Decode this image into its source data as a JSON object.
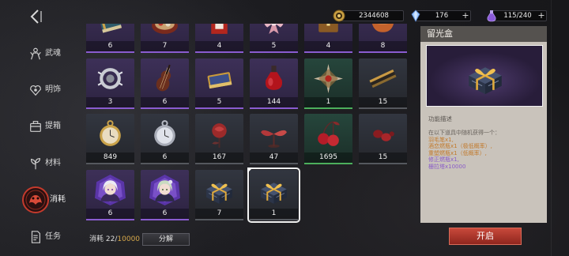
{
  "nav": {
    "back_icon": "back-icon"
  },
  "sidebar": {
    "items": [
      {
        "label": "武魂",
        "icon": "weapon-soul-icon"
      },
      {
        "label": "明饰",
        "icon": "ornament-icon"
      },
      {
        "label": "提箱",
        "icon": "case-icon"
      },
      {
        "label": "材料",
        "icon": "material-icon"
      },
      {
        "label": "消耗",
        "icon": "consumable-icon",
        "selected": true
      },
      {
        "label": "任务",
        "icon": "task-icon"
      }
    ]
  },
  "currencies": [
    {
      "icon": "gold-coin-icon",
      "value": "2344608"
    },
    {
      "icon": "crystal-icon",
      "value": "176",
      "plus": "+"
    },
    {
      "icon": "potion-icon",
      "value": "115/240",
      "plus": "+"
    }
  ],
  "inventory": {
    "palette": {
      "purple": {
        "bg_top": "#3d3058",
        "bg": "#2c2340",
        "bar": "#8a5cd0"
      },
      "green": {
        "bg_top": "#26463c",
        "bg": "#1b2e28",
        "bar": "#4caf5c"
      },
      "gray": {
        "bg_top": "#323640",
        "bg": "#24262b",
        "bar": "#55585e"
      }
    },
    "rows": [
      [
        {
          "count": "6",
          "icon": "book-icon",
          "tint": "purple"
        },
        {
          "count": "7",
          "icon": "plate-icon",
          "tint": "purple"
        },
        {
          "count": "4",
          "icon": "red-bottle-icon",
          "tint": "purple"
        },
        {
          "count": "5",
          "icon": "pink-bow-icon",
          "tint": "purple"
        },
        {
          "count": "4",
          "icon": "gold-chest-icon",
          "tint": "purple"
        },
        {
          "count": "8",
          "icon": "bowl-icon",
          "tint": "purple"
        }
      ],
      [
        {
          "count": "3",
          "icon": "silver-brooch-icon",
          "tint": "purple"
        },
        {
          "count": "6",
          "icon": "violin-icon",
          "tint": "purple"
        },
        {
          "count": "5",
          "icon": "jewelry-box-icon",
          "tint": "purple"
        },
        {
          "count": "144",
          "icon": "red-potion-icon",
          "tint": "purple"
        },
        {
          "count": "1",
          "icon": "star-compass-icon",
          "tint": "green"
        },
        {
          "count": "15",
          "icon": "harmonica-icon",
          "tint": "gray"
        }
      ],
      [
        {
          "count": "849",
          "icon": "gold-pocket-watch-icon",
          "tint": "gray"
        },
        {
          "count": "6",
          "icon": "silver-pocket-watch-icon",
          "tint": "gray"
        },
        {
          "count": "167",
          "icon": "red-rose-icon",
          "tint": "gray"
        },
        {
          "count": "47",
          "icon": "red-sprout-icon",
          "tint": "gray"
        },
        {
          "count": "1695",
          "icon": "red-cherry-icon",
          "tint": "green"
        },
        {
          "count": "15",
          "icon": "red-seeds-icon",
          "tint": "gray"
        }
      ],
      [
        {
          "count": "6",
          "icon": "portrait-white-hair-icon",
          "tint": "purple"
        },
        {
          "count": "6",
          "icon": "portrait-green-hair-icon",
          "tint": "purple"
        },
        {
          "count": "7",
          "icon": "gift-box-icon",
          "tint": "gray"
        },
        {
          "count": "1",
          "icon": "gift-box-icon",
          "tint": "gray",
          "selected": true
        }
      ]
    ]
  },
  "detail": {
    "title": "留光盒",
    "preview_icon": "gift-box-icon",
    "section_label": "功能描述",
    "intro": "在以下道具中随机获得一个：",
    "rewards": [
      {
        "text": "羽毛笔x1,",
        "color": "#c27a2c"
      },
      {
        "text": "酒恋燃瓶x1（极低概率）,",
        "color": "#c27a2c"
      },
      {
        "text": "重塑燃瓶x1（低概率）,",
        "color": "#c27a2c"
      },
      {
        "text": "修正燃瓶x1,",
        "color": "#8a5cc8"
      },
      {
        "text": "栅拉塔x10000",
        "color": "#8a5cc8"
      }
    ]
  },
  "footer": {
    "capacity": {
      "label": "消耗",
      "used": "22",
      "separator": "/",
      "total": "10000"
    },
    "decompose_label": "分解",
    "open_label": "开启"
  }
}
